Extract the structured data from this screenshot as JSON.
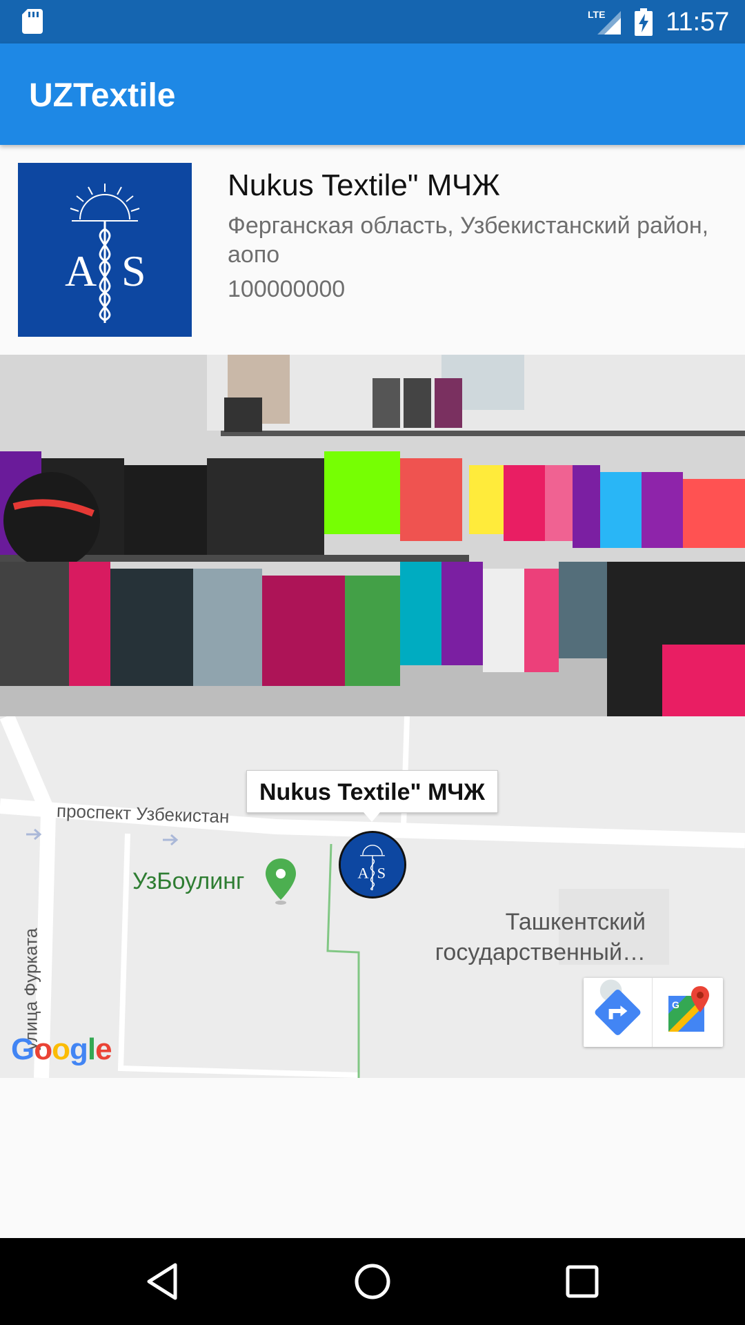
{
  "status_bar": {
    "network": "LTE",
    "time": "11:57",
    "icons": [
      "sd-card-icon",
      "lte-signal-icon",
      "battery-charging-icon"
    ]
  },
  "app_bar": {
    "title": "UZTextile"
  },
  "company": {
    "name": "Nukus Textile\" МЧЖ",
    "address": "Ферганская область, Узбекистанский район, аопо",
    "phone": "100000000",
    "logo_icon": "as-caduceus-logo-icon",
    "logo_color": "#0d47a1"
  },
  "store_photo": {
    "icon": "store-interior-photo"
  },
  "map": {
    "info_window_title": "Nukus Textile\" МЧЖ",
    "streets": {
      "prospect": "проспект Узбекистан",
      "furkat": "улица Фурката"
    },
    "poi_name": "УзБоулинг",
    "university_name": "Ташкентский государственный…",
    "google_logo": {
      "letters": [
        "G",
        "o",
        "o",
        "g",
        "l",
        "e"
      ],
      "colors": [
        "#4285f4",
        "#ea4335",
        "#fbbc05",
        "#4285f4",
        "#34a853",
        "#ea4335"
      ]
    },
    "toolbar_icons": [
      "directions-icon",
      "google-maps-icon"
    ]
  },
  "nav_bar": {
    "icons": [
      "back-icon",
      "home-icon",
      "recents-icon"
    ]
  },
  "colors": {
    "status_bar": "#1565b0",
    "app_bar": "#1e88e5",
    "poi_green": "#2e7d32"
  }
}
